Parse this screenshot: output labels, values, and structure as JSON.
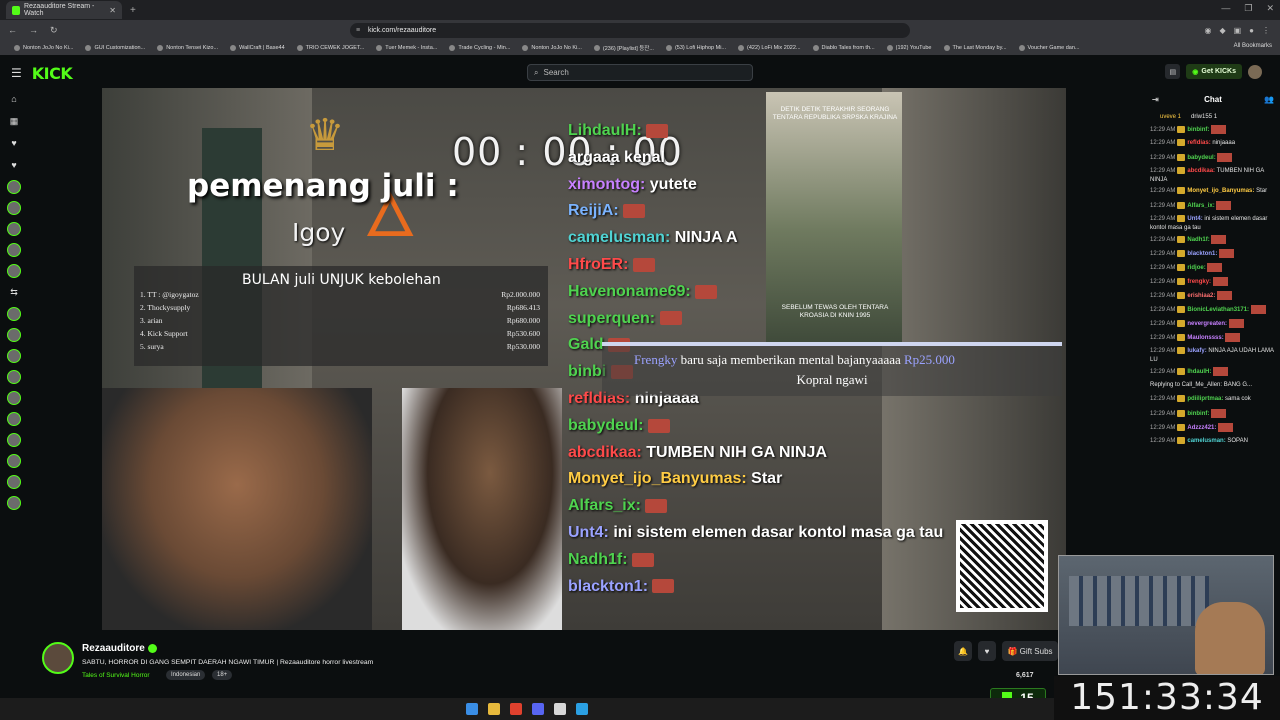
{
  "browser": {
    "tab_title": "Rezaauditore Stream - Watch",
    "url": "kick.com/rezaauditore",
    "bookmarks": [
      "Nonton JoJo No Ki...",
      "GUI Customization...",
      "Nonton Tensei Kizo...",
      "WallCraft | Base44",
      "TRIO CEWEK JOGET...",
      "Tuer Memek - Insta...",
      "Trade Cycling - Min...",
      "Nonton JoJo No Ki...",
      "(236) [Playlist] 등잔...",
      "(53) Lofi Hiphop Mi...",
      "(422) LoFi Mix 2022...",
      "Diablo Tales from th...",
      "(192) YouTube",
      "The Last Monday by...",
      "Voucher Game dan..."
    ],
    "all_bookmarks": "All Bookmarks"
  },
  "header": {
    "logo": "KICK",
    "search_placeholder": "Search",
    "get_kicks": "Get KICKs"
  },
  "stream_overlay": {
    "timer": "00 : 00 : 00",
    "winner_label": "pemenang juli :",
    "winner_name": "Igoy",
    "board_title": "BULAN juli UNJUK kebolehan",
    "board_rows": [
      {
        "rank": "1.",
        "name": "TT : @igoygatoz",
        "amount": "Rp2.000.000"
      },
      {
        "rank": "2.",
        "name": "Thockysupply",
        "amount": "Rp686.413"
      },
      {
        "rank": "3.",
        "name": "arian",
        "amount": "Rp680.000"
      },
      {
        "rank": "4.",
        "name": "Kick Support",
        "amount": "Rp530.600"
      },
      {
        "rank": "5.",
        "name": "surya",
        "amount": "Rp530.000"
      }
    ],
    "overlay_chat": [
      {
        "user": "LihdaulH:",
        "text": "",
        "color": "#4fd34f"
      },
      {
        "user": "",
        "text": "argaaa kenal",
        "color": "#ff7070"
      },
      {
        "user": "ximontog:",
        "text": "yutete",
        "color": "#c780ff"
      },
      {
        "user": "ReijiA:",
        "text": "",
        "color": "#7ab3ff"
      },
      {
        "user": "camelusman:",
        "text": "NINJA A",
        "color": "#50d3d3"
      },
      {
        "user": "HfroER:",
        "text": "",
        "color": "#ff4a4a"
      },
      {
        "user": "Havenoname69:",
        "text": "",
        "color": "#4fd34f"
      },
      {
        "user": "superquen:",
        "text": "",
        "color": "#4fd34f"
      },
      {
        "user": "Gald",
        "text": "",
        "color": "#4fd34f"
      },
      {
        "user": "binbi",
        "text": "",
        "color": "#4fd34f"
      },
      {
        "user": "refldias:",
        "text": "ninjaaaa",
        "color": "#ff4a4a"
      },
      {
        "user": "babydeul:",
        "text": "",
        "color": "#4fd34f"
      },
      {
        "user": "abcdikaa:",
        "text": "TUMBEN NIH GA NINJA",
        "color": "#ff4a4a"
      },
      {
        "user": "Monyet_ijo_Banyumas:",
        "text": "Star",
        "color": "#ffcc44"
      },
      {
        "user": "Alfars_ix:",
        "text": "",
        "color": "#4fd34f"
      },
      {
        "user": "Unt4:",
        "text": "ini sistem elemen dasar kontol masa ga tau",
        "color": "#9aa2ff"
      },
      {
        "user": "Nadh1f:",
        "text": "",
        "color": "#4fd34f"
      },
      {
        "user": "blackton1:",
        "text": "",
        "color": "#9aa2ff"
      }
    ],
    "soldier_top": "DETIK DETIK TERAKHIR SEORANG TENTARA REPUBLIKA SRPSKA KRAJINA",
    "soldier_bottom": "SEBELUM TEWAS OLEH TENTARA KROASIA DI KNIN 1995",
    "notif_user": "Frengky",
    "notif_text": "baru saja memberikan mental bajanyaaaaa",
    "notif_amount": "Rp25.000",
    "notif_msg": "Kopral ngawi"
  },
  "channel": {
    "name": "Rezaauditore",
    "title": "SABTU, HORROR DI GANG SEMPIT DAERAH NGAWI TIMUR | Rezaauditore horror livestream",
    "category": "Tales of Survival Horror",
    "tags": [
      "Indonesian",
      "18+"
    ],
    "gift_subs": "Gift Subs",
    "viewers": "6,617"
  },
  "chat": {
    "title": "Chat",
    "top_gifters": [
      "uveve 1",
      "driw155 1"
    ],
    "messages": [
      {
        "time": "12:29 AM",
        "user": "binbinf:",
        "text": "",
        "color": "#4fd34f",
        "emote": true
      },
      {
        "time": "12:29 AM",
        "user": "refldias:",
        "text": "ninjaaaa",
        "color": "#ff4a4a",
        "emote": false
      },
      {
        "time": "12:29 AM",
        "user": "babydeul:",
        "text": "",
        "color": "#4fd34f",
        "emote": true
      },
      {
        "time": "12:29 AM",
        "user": "abcdikaa:",
        "text": "TUMBEN NIH GA NINJA",
        "color": "#ff4a4a",
        "emote": false
      },
      {
        "time": "12:29 AM",
        "user": "Monyet_ijo_Banyumas:",
        "text": "Star",
        "color": "#ffcc44",
        "emote": false
      },
      {
        "time": "12:29 AM",
        "user": "Alfars_ix:",
        "text": "",
        "color": "#4fd34f",
        "emote": true
      },
      {
        "time": "12:29 AM",
        "user": "Unt4:",
        "text": "ini sistem elemen dasar kontol masa ga tau",
        "color": "#9aa2ff",
        "emote": false
      },
      {
        "time": "12:29 AM",
        "user": "Nadh1f:",
        "text": "",
        "color": "#4fd34f",
        "emote": true
      },
      {
        "time": "12:29 AM",
        "user": "blackton1:",
        "text": "",
        "color": "#9aa2ff",
        "emote": true
      },
      {
        "time": "12:29 AM",
        "user": "ridjoe:",
        "text": "",
        "color": "#4fd34f",
        "emote": true
      },
      {
        "time": "12:29 AM",
        "user": "frengky:",
        "text": "",
        "color": "#ff4a4a",
        "emote": true
      },
      {
        "time": "12:29 AM",
        "user": "erishiaa2:",
        "text": "",
        "color": "#ff7070",
        "emote": true
      },
      {
        "time": "12:29 AM",
        "user": "BionicLeviathan3171:",
        "text": "",
        "color": "#4fd34f",
        "emote": true
      },
      {
        "time": "12:29 AM",
        "user": "nevergreaten:",
        "text": "",
        "color": "#c780ff",
        "emote": true
      },
      {
        "time": "12:29 AM",
        "user": "Maulonssss:",
        "text": "",
        "color": "#c780ff",
        "emote": true
      },
      {
        "time": "12:29 AM",
        "user": "lukafy:",
        "text": "NINJA AJA UDAH LAMA LU",
        "color": "#9aa2ff",
        "emote": false
      },
      {
        "time": "12:29 AM",
        "user": "IhdaulH:",
        "text": "",
        "color": "#4fd34f",
        "emote": true
      },
      {
        "time": "",
        "user": "",
        "text": "Replying to Call_Me_Allen: BANG G...",
        "color": "#aaa",
        "emote": false
      },
      {
        "time": "12:29 AM",
        "user": "pdiiliprtmaa:",
        "text": "sama cok",
        "color": "#4fd34f",
        "emote": false
      },
      {
        "time": "12:29 AM",
        "user": "binbinf:",
        "text": "",
        "color": "#4fd34f",
        "emote": true
      },
      {
        "time": "12:29 AM",
        "user": "Adzzz421:",
        "text": "",
        "color": "#c780ff",
        "emote": true
      },
      {
        "time": "12:29 AM",
        "user": "camelusman:",
        "text": "SOPAN",
        "color": "#50d3d3",
        "emote": false
      }
    ]
  },
  "overlay_clock": "151:33:34",
  "overlay_badge": "15"
}
